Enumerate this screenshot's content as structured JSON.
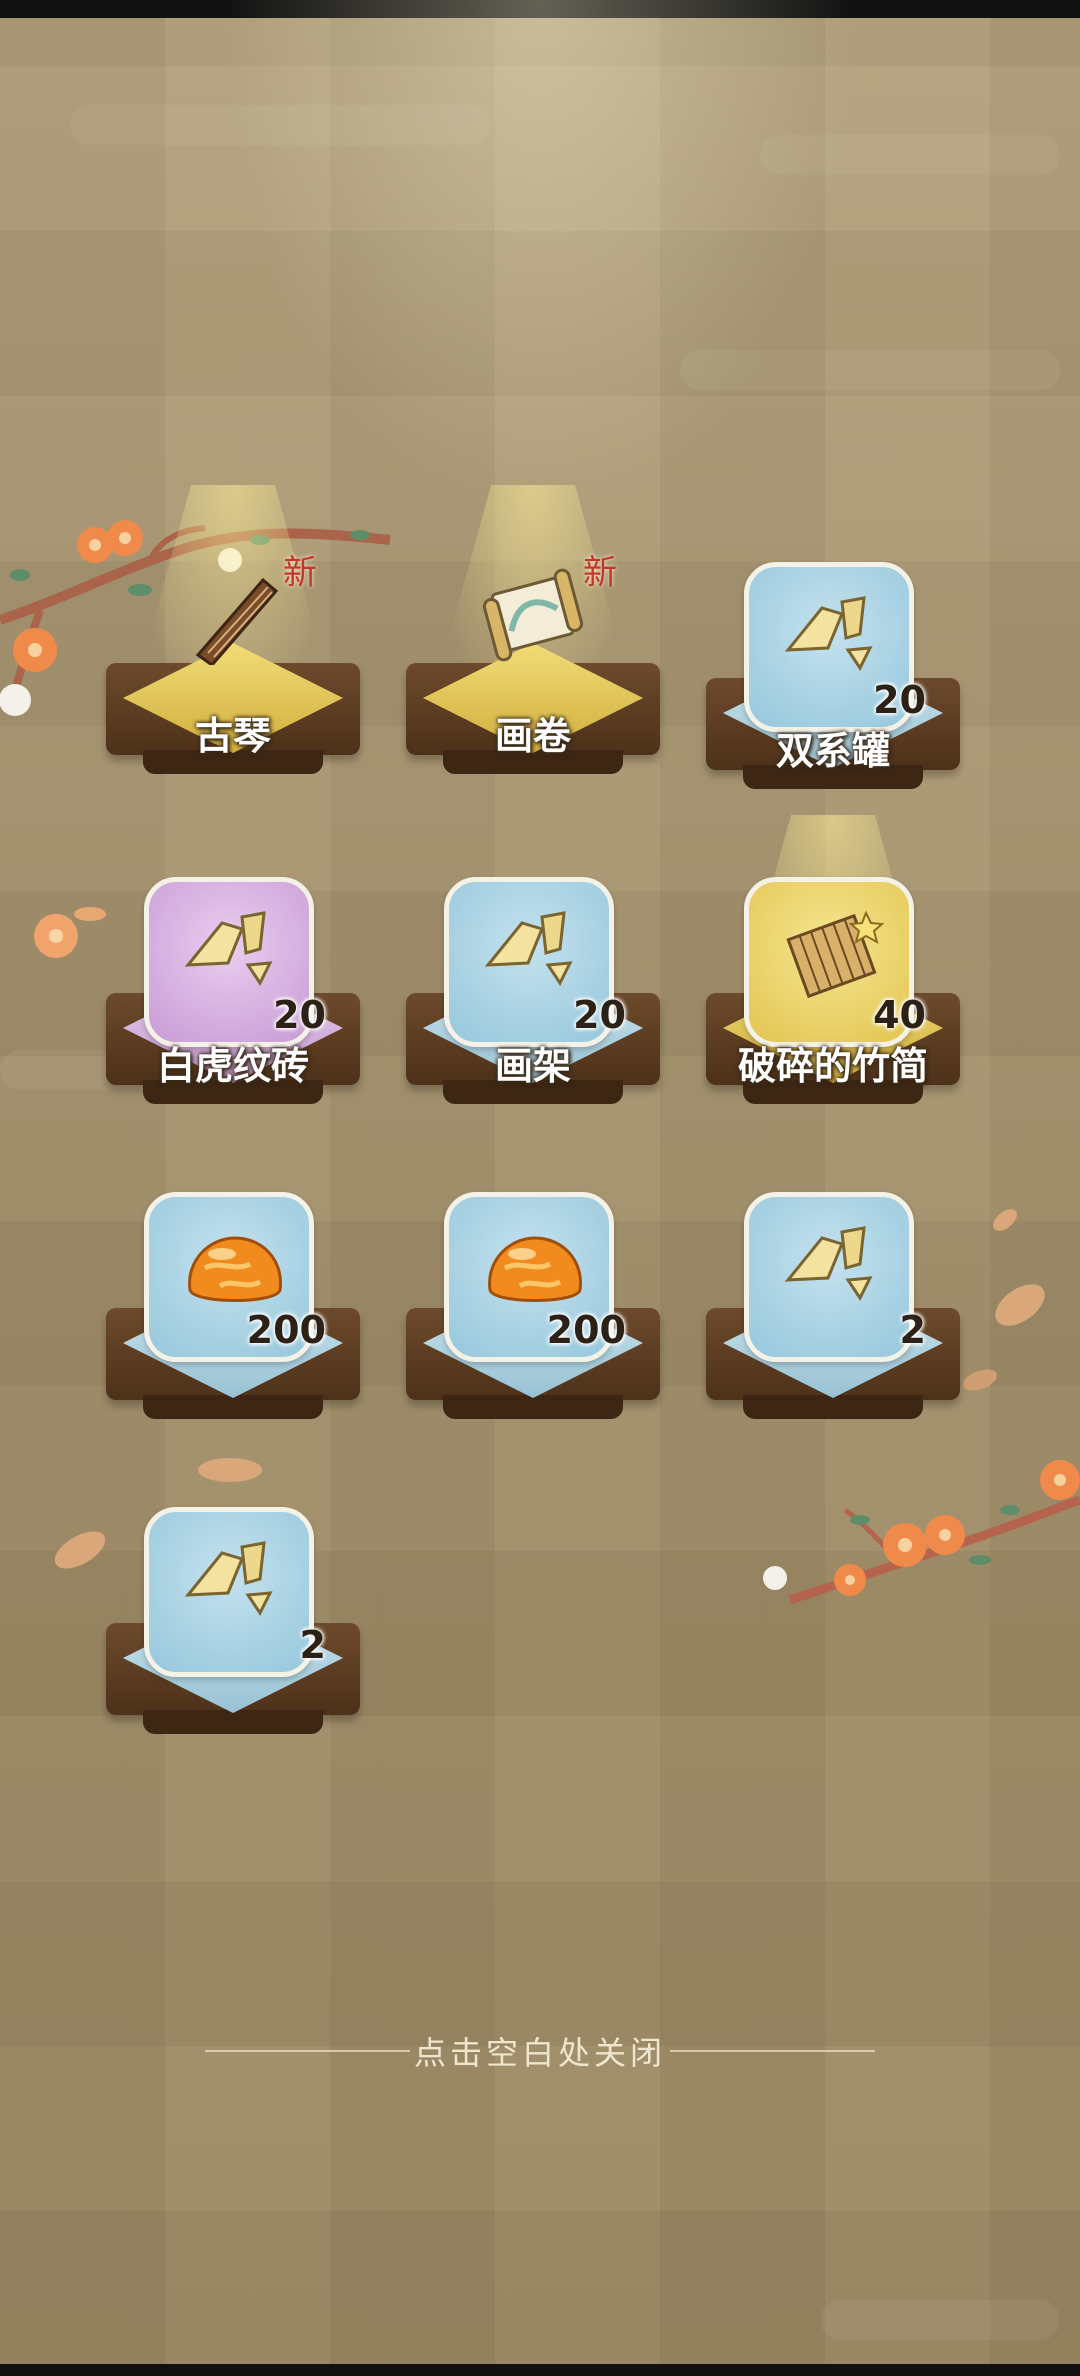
{
  "new_tag": "新",
  "close_hint": "点击空白处关闭",
  "items": [
    {
      "name": "古琴",
      "count": "",
      "is_new": true,
      "icon": "guqin-icon",
      "rarity": "gold"
    },
    {
      "name": "画卷",
      "count": "",
      "is_new": true,
      "icon": "scroll-painting-icon",
      "rarity": "gold"
    },
    {
      "name": "双系罐",
      "count": "20",
      "is_new": false,
      "icon": "fragment-icon",
      "rarity": "blue"
    },
    {
      "name": "白虎纹砖",
      "count": "20",
      "is_new": false,
      "icon": "fragment-icon",
      "rarity": "purple"
    },
    {
      "name": "画架",
      "count": "20",
      "is_new": false,
      "icon": "fragment-icon",
      "rarity": "blue"
    },
    {
      "name": "破碎的竹简",
      "count": "40",
      "is_new": false,
      "icon": "bamboo-slip-icon",
      "rarity": "gold"
    },
    {
      "name": "",
      "count": "200",
      "is_new": false,
      "icon": "amber-stone-icon",
      "rarity": "blue"
    },
    {
      "name": "",
      "count": "200",
      "is_new": false,
      "icon": "amber-stone-icon",
      "rarity": "blue"
    },
    {
      "name": "",
      "count": "2",
      "is_new": false,
      "icon": "fragment-icon",
      "rarity": "blue"
    },
    {
      "name": "",
      "count": "2",
      "is_new": false,
      "icon": "fragment-icon",
      "rarity": "blue"
    }
  ],
  "colors": {
    "gold": "#e8cd5a",
    "blue": "#a8d0e0",
    "purple": "#d3aede",
    "new_tag": "#c4362b"
  }
}
